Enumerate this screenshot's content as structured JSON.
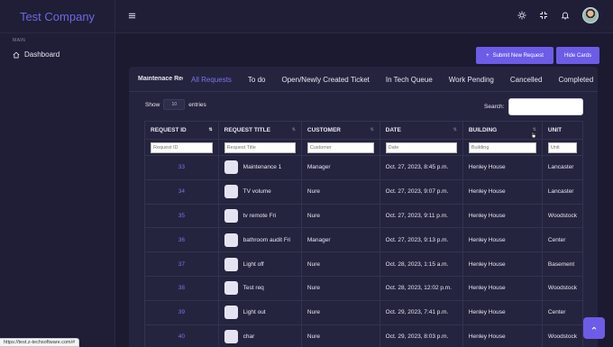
{
  "app": {
    "brand": "Test Company"
  },
  "sidebar": {
    "section_label": "MAIN",
    "items": [
      {
        "label": "Dashboard",
        "icon": "home-icon"
      }
    ]
  },
  "topbar": {
    "icons": [
      "menu-icon",
      "sun-icon",
      "fullscreen-icon",
      "bell-icon",
      "avatar"
    ]
  },
  "actions": {
    "submit_label": "Submit New Request",
    "hide_label": "Hide Cards"
  },
  "card": {
    "title": "Maintenace Requests",
    "tabs": [
      "All Requests",
      "To do",
      "Open/Newly Created Ticket",
      "In Tech Queue",
      "Work Pending",
      "Cancelled",
      "Completed"
    ],
    "active_tab": "All Requests"
  },
  "table_controls": {
    "show_label": "Show",
    "entries_value": "10",
    "entries_label": "entries",
    "search_label": "Search:"
  },
  "table": {
    "columns": [
      {
        "label": "REQUEST ID",
        "filter": "Request ID"
      },
      {
        "label": "REQUEST TITLE",
        "filter": "Request Title"
      },
      {
        "label": "CUSTOMER",
        "filter": "Customer"
      },
      {
        "label": "DATE",
        "filter": "Date"
      },
      {
        "label": "BUILDING",
        "filter": "Building"
      },
      {
        "label": "UNIT",
        "filter": "Unit"
      }
    ],
    "rows": [
      {
        "id": "33",
        "title": "Maintenance 1",
        "customer": "Manager",
        "date": "Oct. 27, 2023, 8:45 p.m.",
        "building": "Henley House",
        "unit": "Lancaster"
      },
      {
        "id": "34",
        "title": "TV volume",
        "customer": "Nure",
        "date": "Oct. 27, 2023, 9:07 p.m.",
        "building": "Henley House",
        "unit": "Lancaster"
      },
      {
        "id": "35",
        "title": "tv remote Fri",
        "customer": "Nure",
        "date": "Oct. 27, 2023, 9:11 p.m.",
        "building": "Henley House",
        "unit": "Woodstock"
      },
      {
        "id": "36",
        "title": "bathroom audit Fri",
        "customer": "Manager",
        "date": "Oct. 27, 2023, 9:13 p.m.",
        "building": "Henley House",
        "unit": "Center"
      },
      {
        "id": "37",
        "title": "Light off",
        "customer": "Nure",
        "date": "Oct. 28, 2023, 1:15 a.m.",
        "building": "Henley House",
        "unit": "Basement"
      },
      {
        "id": "38",
        "title": "Test req",
        "customer": "Nure",
        "date": "Oct. 28, 2023, 12:02 p.m.",
        "building": "Henley House",
        "unit": "Woodstock"
      },
      {
        "id": "39",
        "title": "Light out",
        "customer": "Nure",
        "date": "Oct. 29, 2023, 7:41 p.m.",
        "building": "Henley House",
        "unit": "Center"
      },
      {
        "id": "40",
        "title": "char",
        "customer": "Nure",
        "date": "Oct. 29, 2023, 8:03 p.m.",
        "building": "Henley House",
        "unit": "Woodstock"
      }
    ]
  },
  "status_url": "https://test.z-techsoftware.com/#"
}
